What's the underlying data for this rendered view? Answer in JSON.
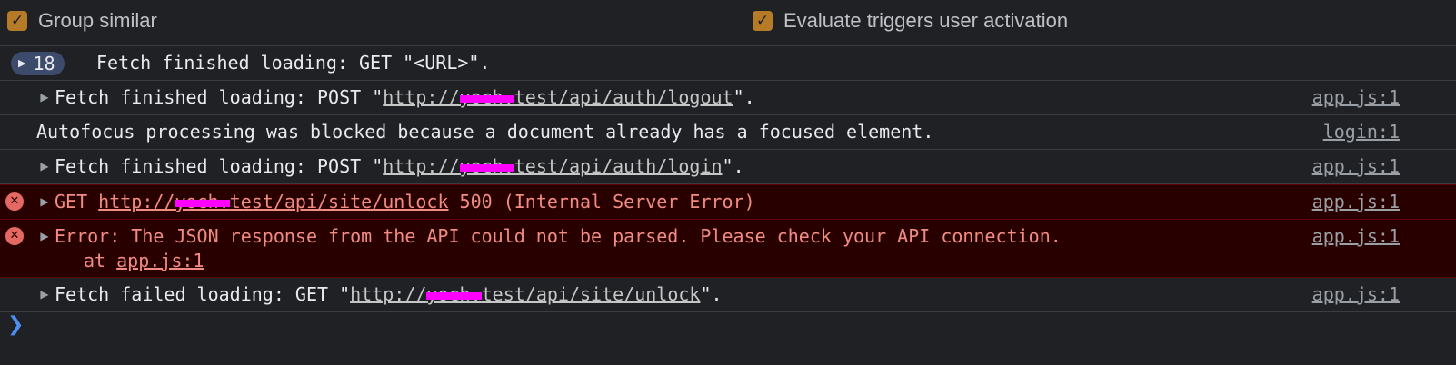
{
  "toolbar": {
    "group_similar": {
      "label": "Group similar",
      "checked": true,
      "check": "✓"
    },
    "evaluate_triggers": {
      "label": "Evaluate triggers user activation",
      "checked": true,
      "check": "✓"
    }
  },
  "group": {
    "count": "18",
    "message": "Fetch finished loading: GET \"<URL>\"."
  },
  "rows": [
    {
      "pre": "Fetch finished loading: POST \"",
      "url_pre": "http://",
      "url_redacted": "yoch.",
      "url_post": "test/api/auth/logout",
      "post": "\".",
      "source": "app.js:1"
    },
    {
      "message": "Autofocus processing was blocked because a document already has a focused element.",
      "source": "login:1"
    },
    {
      "pre": "Fetch finished loading: POST \"",
      "url_pre": "http://",
      "url_redacted": "yoch.",
      "url_post": "test/api/auth/login",
      "post": "\".",
      "source": "app.js:1"
    },
    {
      "pre": "GET ",
      "url_pre": "http://",
      "url_redacted": "yoch.",
      "url_post": "test/api/site/unlock",
      "post": " 500 (Internal Server Error)",
      "source": "app.js:1"
    },
    {
      "message": "Error: The JSON response from the API could not be parsed. Please check your API connection.",
      "at": "at ",
      "at_link": "app.js:1",
      "source": "app.js:1"
    },
    {
      "pre": "Fetch failed loading: GET \"",
      "url_pre": "http://",
      "url_redacted": "yoch.",
      "url_post": "test/api/site/unlock",
      "post": "\".",
      "source": "app.js:1"
    }
  ],
  "icons": {
    "expand": "▶",
    "error": "✕",
    "prompt": "❯"
  },
  "colors": {
    "checkbox": "#b57b27",
    "error_bg": "#290000",
    "error_text": "#f28b82",
    "badge": "#3c4a6b",
    "prompt": "#4d8ff0",
    "redaction": "#ff00ff"
  }
}
